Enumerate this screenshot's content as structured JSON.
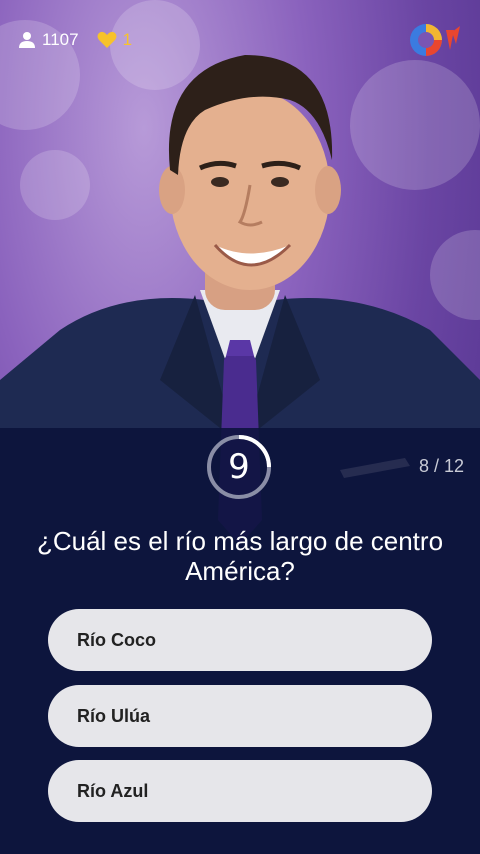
{
  "header": {
    "viewers": "1107",
    "lives": "1",
    "logo_icon": "q-logo-icon"
  },
  "question": {
    "timer": "9",
    "progress": "8 / 12",
    "text": "¿Cuál es el río más largo de centro América?"
  },
  "answers": [
    {
      "label": "Río Coco"
    },
    {
      "label": "Río Ulúa"
    },
    {
      "label": "Río Azul"
    }
  ],
  "colors": {
    "background": "#6a45a3",
    "panel": "#0a123a",
    "answer_bg": "#e6e6ea",
    "heart": "#f7c22b"
  }
}
